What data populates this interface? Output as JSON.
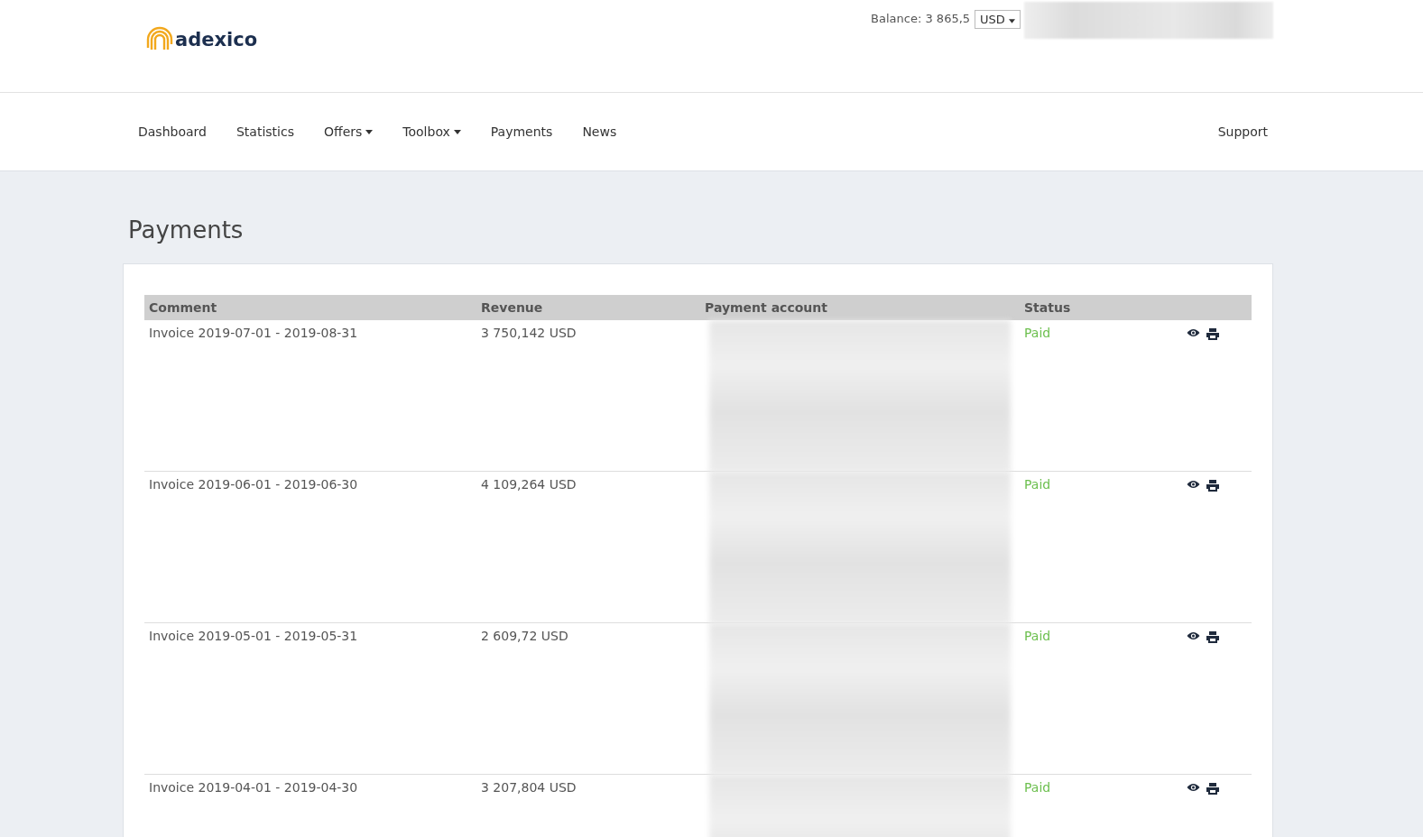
{
  "header": {
    "logo": "adexico",
    "balance_label": "Balance: 3 865,5",
    "currency": "USD"
  },
  "nav": {
    "items": [
      {
        "label": "Dashboard",
        "dropdown": false
      },
      {
        "label": "Statistics",
        "dropdown": false
      },
      {
        "label": "Offers",
        "dropdown": true
      },
      {
        "label": "Toolbox",
        "dropdown": true
      },
      {
        "label": "Payments",
        "dropdown": false
      },
      {
        "label": "News",
        "dropdown": false
      }
    ],
    "support": "Support"
  },
  "page_title": "Payments",
  "table": {
    "columns": [
      "Comment",
      "Revenue",
      "Payment account",
      "Status"
    ],
    "rows": [
      {
        "comment": "Invoice 2019-07-01 - 2019-08-31",
        "revenue": "3 750,142 USD",
        "status": "Paid"
      },
      {
        "comment": "Invoice 2019-06-01 - 2019-06-30",
        "revenue": "4 109,264 USD",
        "status": "Paid"
      },
      {
        "comment": "Invoice 2019-05-01 - 2019-05-31",
        "revenue": "2 609,72 USD",
        "status": "Paid"
      },
      {
        "comment": "Invoice 2019-04-01 - 2019-04-30",
        "revenue": "3 207,804 USD",
        "status": "Paid"
      }
    ]
  }
}
